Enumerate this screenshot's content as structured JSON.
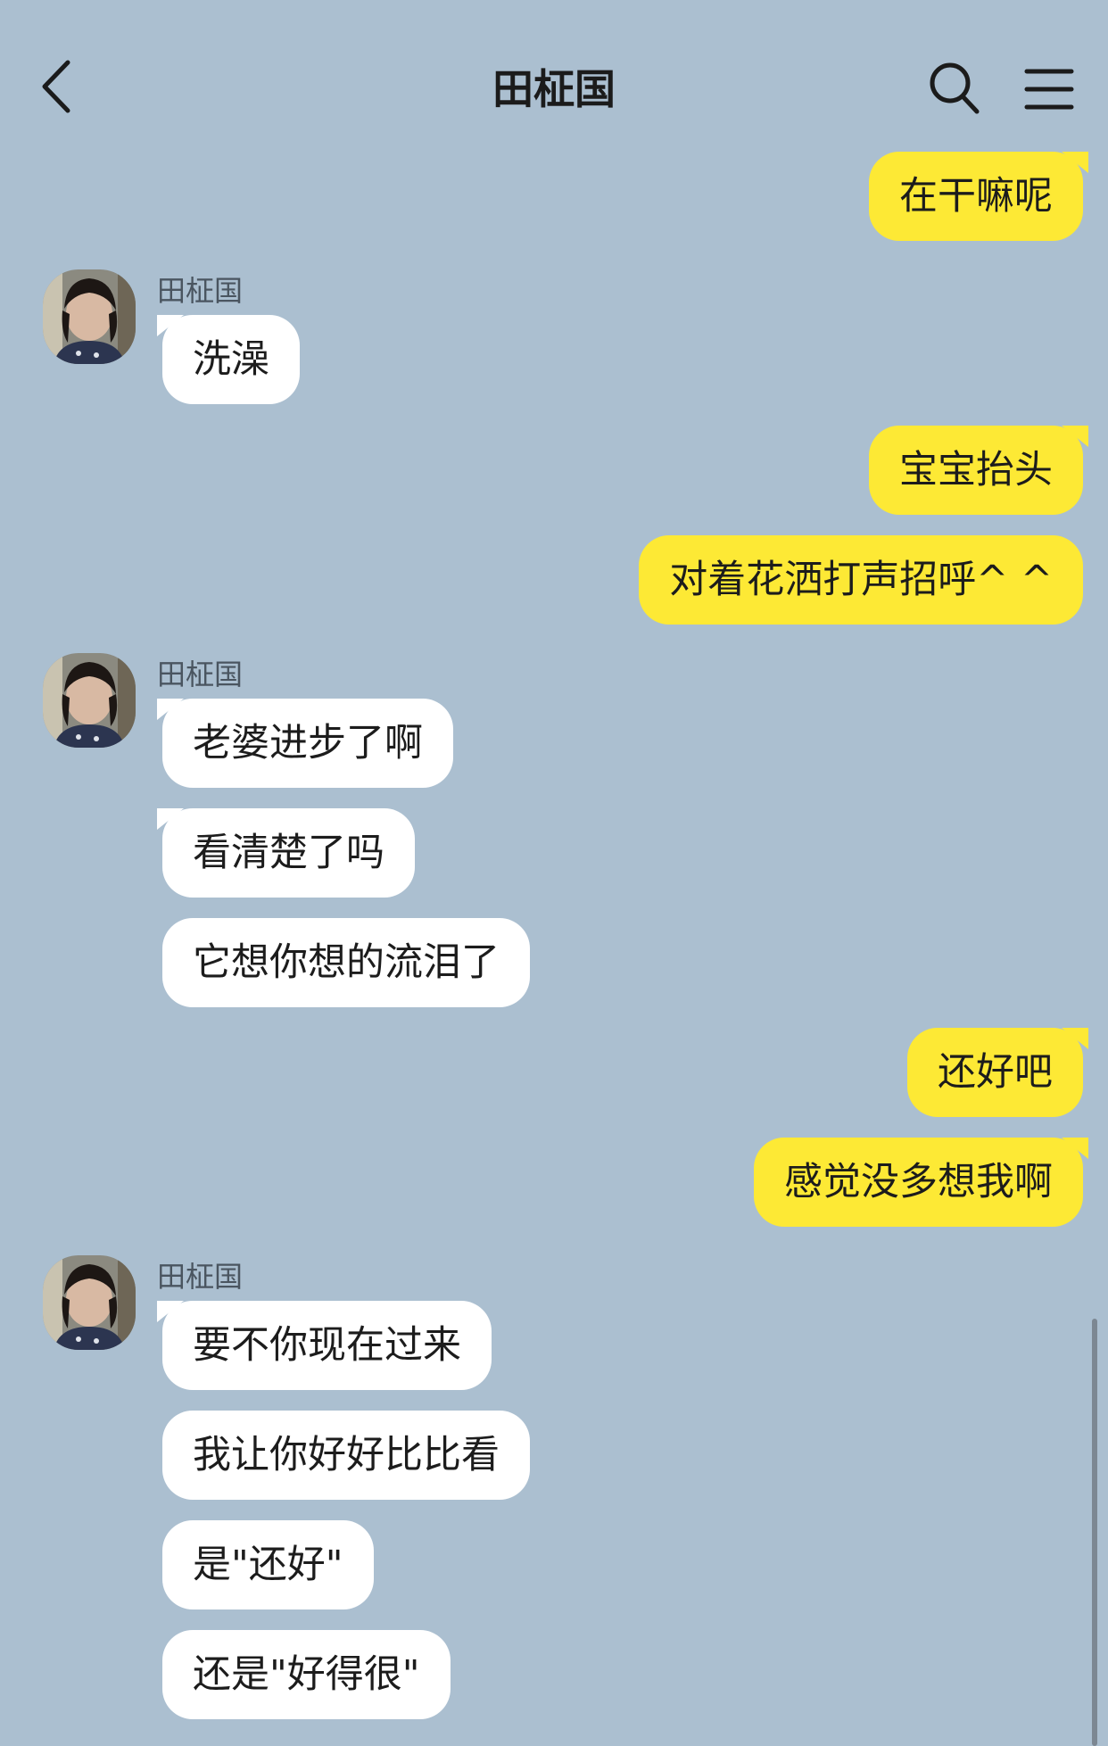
{
  "header": {
    "title": "田柾国"
  },
  "icons": {
    "back": "chevron-left-icon",
    "search": "search-icon",
    "menu": "hamburger-menu-icon"
  },
  "colors": {
    "background": "#abbfd0",
    "my_bubble": "#fde935",
    "their_bubble": "#ffffff"
  },
  "messages": [
    {
      "from": "me",
      "text": "在干嘛呢"
    },
    {
      "from": "them",
      "sender": "田柾国",
      "text": "洗澡"
    },
    {
      "from": "me",
      "text": "宝宝抬头"
    },
    {
      "from": "me",
      "text": "对着花洒打声招呼^ ^"
    },
    {
      "from": "them",
      "sender": "田柾国",
      "text": "老婆进步了啊"
    },
    {
      "from": "them",
      "text": "看清楚了吗"
    },
    {
      "from": "them",
      "text": "它想你想的流泪了"
    },
    {
      "from": "me",
      "text": "还好吧"
    },
    {
      "from": "me",
      "text": "感觉没多想我啊"
    },
    {
      "from": "them",
      "sender": "田柾国",
      "text": "要不你现在过来"
    },
    {
      "from": "them",
      "text": "我让你好好比比看"
    },
    {
      "from": "them",
      "text": "是\"还好\""
    },
    {
      "from": "them",
      "text": "还是\"好得很\""
    }
  ]
}
